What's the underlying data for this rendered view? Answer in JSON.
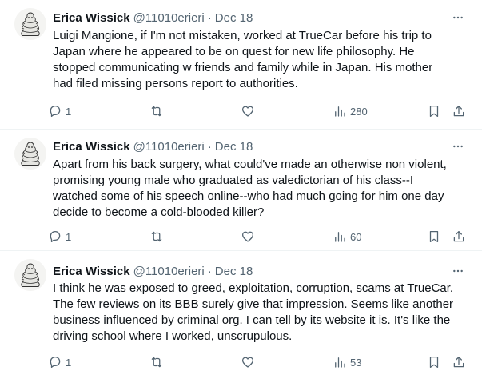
{
  "tweets": [
    {
      "name": "Erica Wissick",
      "handle": "@11010erieri",
      "separator": "·",
      "date": "Dec 18",
      "text": "Luigi Mangione, if I'm not mistaken, worked at TrueCar before his trip to\nJapan where he appeared to be on quest for new life philosophy. He\nstopped communicating w friends and family while in Japan. His mother\nhad filed missing persons report to authorities.",
      "replies": "1",
      "views": "280"
    },
    {
      "name": "Erica Wissick",
      "handle": "@11010erieri",
      "separator": "·",
      "date": "Dec 18",
      "text": "Apart from his back surgery, what could've made an otherwise non violent,\npromising young male who graduated as valedictorian of his class--I\nwatched some of his speech online--who had much going for him one day\ndecide to become a cold-blooded killer?",
      "replies": "1",
      "views": "60"
    },
    {
      "name": "Erica Wissick",
      "handle": "@11010erieri",
      "separator": "·",
      "date": "Dec 18",
      "text": "I think he was exposed to greed, exploitation, corruption, scams at TrueCar.\nThe few reviews on its BBB surely give that impression. Seems like another\nbusiness influenced by criminal org. I can tell by its website it is. It's like the\ndriving school where I worked, unscrupulous.",
      "replies": "1",
      "views": "53"
    }
  ],
  "icons": {
    "reply": "reply-icon",
    "retweet": "retweet-icon",
    "like": "like-icon",
    "views": "views-icon",
    "bookmark": "bookmark-icon",
    "share": "share-icon",
    "more": "more-icon"
  },
  "colors": {
    "text": "#0f1419",
    "secondary": "#536471",
    "divider": "#eff3f4"
  }
}
